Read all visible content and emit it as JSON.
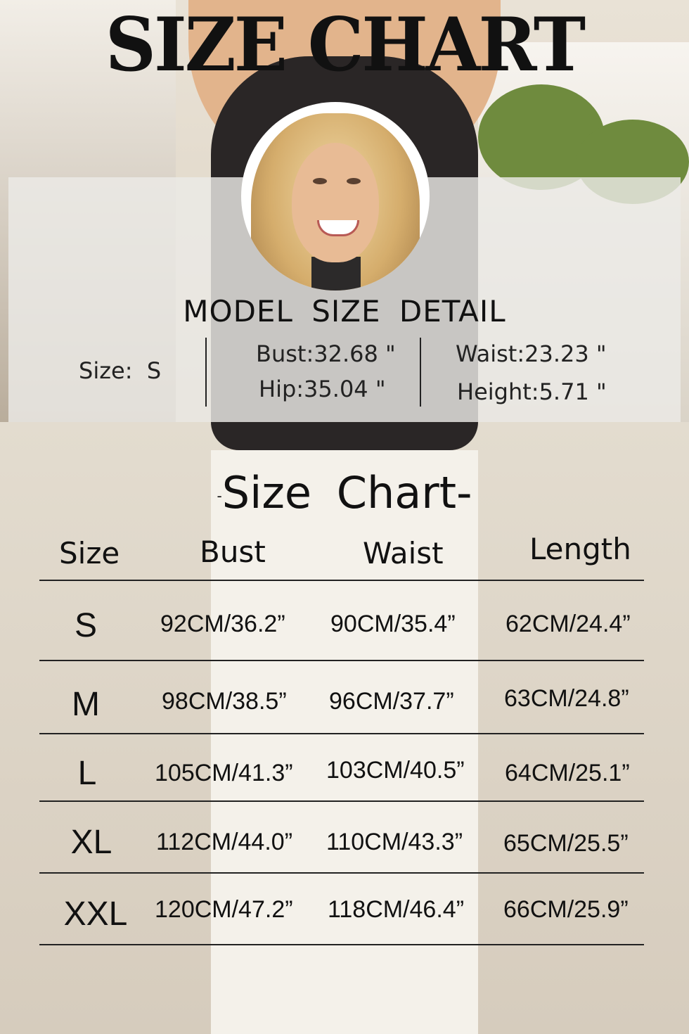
{
  "title": "SIZE CHART",
  "model_detail": {
    "heading": "MODEL  SIZE  DETAIL",
    "size": "Size:  S",
    "bust": "Bust:32.68 \"",
    "hip": "Hip:35.04 \"",
    "waist": "Waist:23.23 \"",
    "height": "Height:5.71 \""
  },
  "size_chart": {
    "heading": "Size  Chart-",
    "heading_prefix": "-",
    "columns": [
      "Size",
      "Bust",
      "Waist",
      "Length"
    ],
    "rows": [
      {
        "size": "S",
        "bust": "92CM/36.2”",
        "waist": "90CM/35.4”",
        "length": "62CM/24.4”"
      },
      {
        "size": "M",
        "bust": "98CM/38.5”",
        "waist": "96CM/37.7”",
        "length": "63CM/24.8”"
      },
      {
        "size": "L",
        "bust": "105CM/41.3”",
        "waist": "103CM/40.5”",
        "length": "64CM/25.1”"
      },
      {
        "size": "XL",
        "bust": "112CM/44.0”",
        "waist": "110CM/43.3”",
        "length": "65CM/25.5”"
      },
      {
        "size": "XXL",
        "bust": "120CM/47.2”",
        "waist": "118CM/46.4”",
        "length": "66CM/25.9”"
      }
    ]
  }
}
